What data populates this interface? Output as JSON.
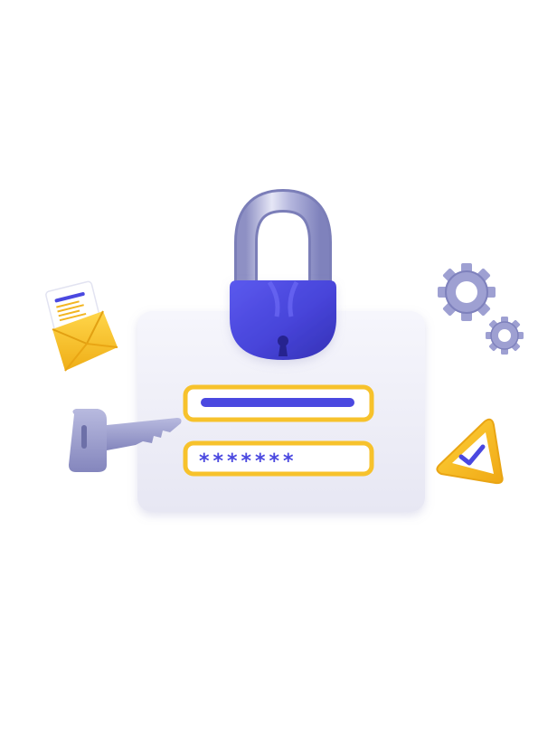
{
  "illustration": {
    "password_field": {
      "masked_value": "*******"
    },
    "colors": {
      "accent_blue": "#4A48E0",
      "accent_yellow": "#F7C22C",
      "card_white": "#F3F3FA",
      "metal_gray": "#9A9CC9",
      "envelope_yellow": "#F6C530"
    },
    "icons": [
      "padlock-icon",
      "key-icon",
      "envelope-icon",
      "gear-icon",
      "warning-check-icon"
    ]
  }
}
